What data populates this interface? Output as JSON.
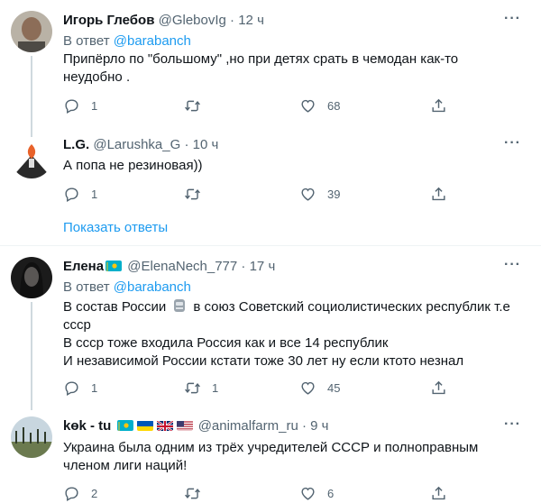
{
  "tweets": [
    {
      "name": "Игорь Глебов",
      "handle": "@GlebovIg",
      "dot": "·",
      "time": "12 ч",
      "reply_prefix": "В ответ",
      "reply_to": "@barabanch",
      "text": "Припёрло по \"большому\" ,но при детях срать в чемодан как-то неудобно .",
      "replies": "1",
      "retweets": "",
      "likes": "68"
    },
    {
      "name": "L.G.",
      "handle": "@Larushka_G",
      "dot": "·",
      "time": "10 ч",
      "text": "А попа не резиновая))",
      "replies": "1",
      "retweets": "",
      "likes": "39"
    },
    {
      "name": "Елена",
      "handle": "@ElenaNech_777",
      "dot": "·",
      "time": "17 ч",
      "reply_prefix": "В ответ",
      "reply_to": "@barabanch",
      "text_line1a": "В состав России",
      "text_line1b": "в союз Советский социолистических республик т.е",
      "text_line2": "ссср",
      "text_line3": "В ссср тоже входила Россия как и все 14 республик",
      "text_line4": "И независимой России кстати тоже 30 лет ну если ктото незнал",
      "replies": "1",
      "retweets": "1",
      "likes": "45"
    },
    {
      "name": "kөk - tu",
      "handle": "@animalfarm_ru",
      "dot": "·",
      "time": "9 ч",
      "text": "Украина была одним из трёх учредителей СССР и полноправным членом лиги наций!",
      "replies": "2",
      "retweets": "",
      "likes": "6"
    }
  ],
  "show_replies": "Показать ответы",
  "more_label": "···",
  "colors": {
    "accent": "#1d9bf0",
    "muted": "#536471",
    "line": "#cfd9de",
    "divider": "#eff3f4"
  },
  "icons": [
    "reply-icon",
    "retweet-icon",
    "like-icon",
    "share-icon",
    "more-icon",
    "kazakhstan-flag-icon",
    "ukraine-flag-icon",
    "uk-flag-icon",
    "usa-flag-icon",
    "robot-emoji-icon"
  ]
}
